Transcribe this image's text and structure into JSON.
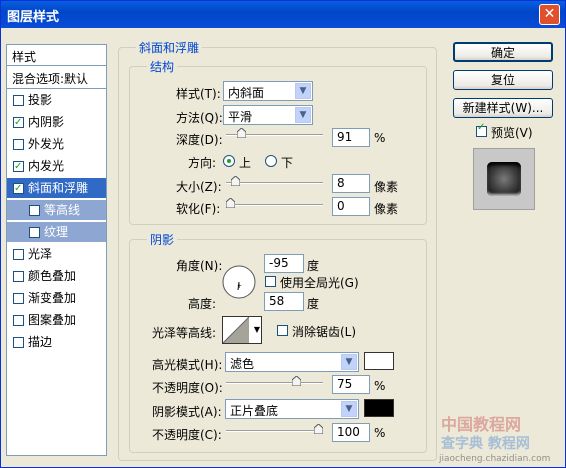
{
  "window": {
    "title": "图层样式",
    "close_glyph": "✕"
  },
  "styles_list": {
    "header": "样式",
    "blend_options": "混合选项:默认",
    "items": [
      {
        "label": "投影",
        "checked": false
      },
      {
        "label": "内阴影",
        "checked": true
      },
      {
        "label": "外发光",
        "checked": false
      },
      {
        "label": "内发光",
        "checked": true
      },
      {
        "label": "斜面和浮雕",
        "checked": true,
        "selected": true
      },
      {
        "label": "等高线",
        "checked": false,
        "sub": true
      },
      {
        "label": "纹理",
        "checked": false,
        "sub": true
      },
      {
        "label": "光泽",
        "checked": false
      },
      {
        "label": "颜色叠加",
        "checked": false
      },
      {
        "label": "渐变叠加",
        "checked": false
      },
      {
        "label": "图案叠加",
        "checked": false
      },
      {
        "label": "描边",
        "checked": false
      }
    ]
  },
  "bevel": {
    "group_title": "斜面和浮雕",
    "structure": {
      "title": "结构",
      "style_label": "样式(T):",
      "style_value": "内斜面",
      "technique_label": "方法(Q):",
      "technique_value": "平滑",
      "depth_label": "深度(D):",
      "depth_value": "91",
      "depth_unit": "%",
      "depth_level": 0.12,
      "direction_label": "方向:",
      "direction_up": "上",
      "direction_down": "下",
      "size_label": "大小(Z):",
      "size_value": "8",
      "size_unit": "像素",
      "size_level": 0.06,
      "soften_label": "软化(F):",
      "soften_value": "0",
      "soften_unit": "像素",
      "soften_level": 0.0
    },
    "shading": {
      "title": "阴影",
      "angle_label": "角度(N):",
      "angle_value": "-95",
      "angle_unit": "度",
      "global_light_label": "使用全局光(G)",
      "altitude_label": "高度:",
      "altitude_value": "58",
      "altitude_unit": "度",
      "gloss_label": "光泽等高线:",
      "antialias_label": "消除锯齿(L)",
      "highlight_mode_label": "高光模式(H):",
      "highlight_mode_value": "滤色",
      "highlight_color": "#ffffff",
      "highlight_opacity_label": "不透明度(O):",
      "highlight_opacity_value": "75",
      "highlight_opacity_level": 0.75,
      "shadow_mode_label": "阴影模式(A):",
      "shadow_mode_value": "正片叠底",
      "shadow_color": "#000000",
      "shadow_opacity_label": "不透明度(C):",
      "shadow_opacity_value": "100",
      "shadow_opacity_level": 1.0,
      "percent": "%"
    }
  },
  "buttons": {
    "ok": "确定",
    "reset": "复位",
    "new_style": "新建样式(W)...",
    "preview": "预览(V)"
  },
  "watermark": {
    "line1": "中国教程网",
    "line2": "查字典 教程网",
    "line3": "jiaocheng.chazidian.com"
  }
}
